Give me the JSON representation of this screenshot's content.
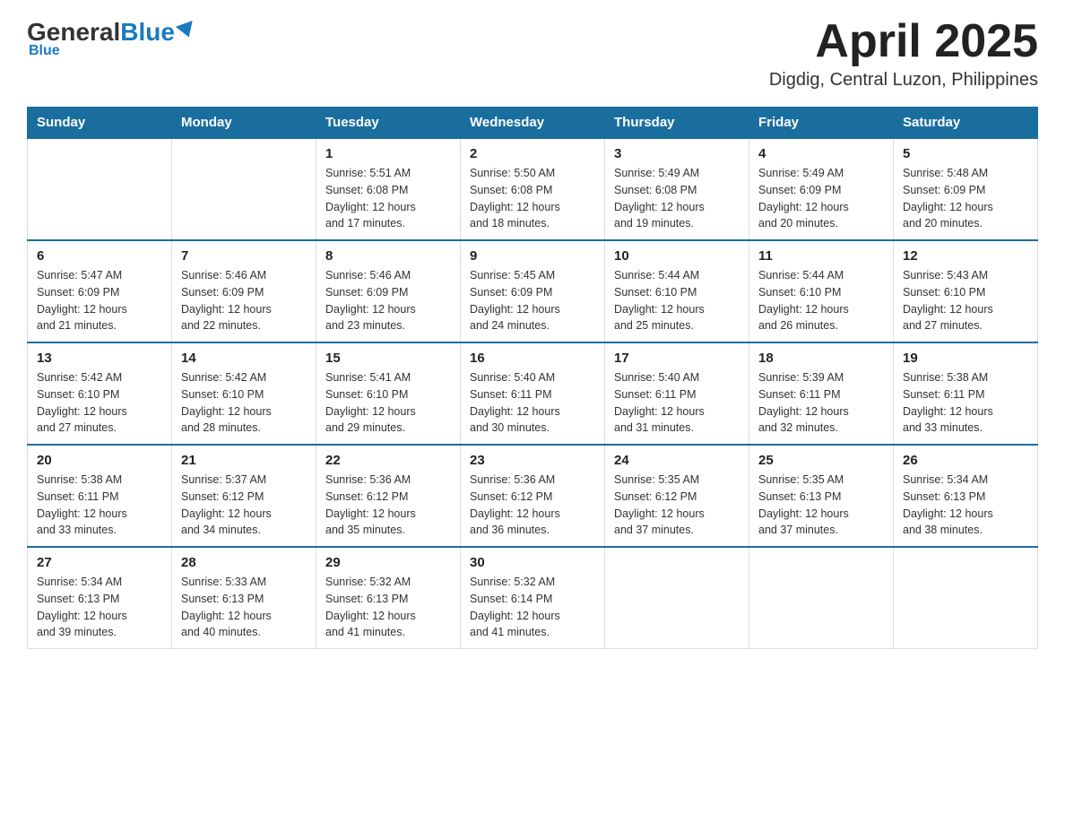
{
  "logo": {
    "general": "General",
    "blue": "Blue"
  },
  "title": "April 2025",
  "subtitle": "Digdig, Central Luzon, Philippines",
  "days_of_week": [
    "Sunday",
    "Monday",
    "Tuesday",
    "Wednesday",
    "Thursday",
    "Friday",
    "Saturday"
  ],
  "weeks": [
    [
      {
        "day": "",
        "info": ""
      },
      {
        "day": "",
        "info": ""
      },
      {
        "day": "1",
        "info": "Sunrise: 5:51 AM\nSunset: 6:08 PM\nDaylight: 12 hours\nand 17 minutes."
      },
      {
        "day": "2",
        "info": "Sunrise: 5:50 AM\nSunset: 6:08 PM\nDaylight: 12 hours\nand 18 minutes."
      },
      {
        "day": "3",
        "info": "Sunrise: 5:49 AM\nSunset: 6:08 PM\nDaylight: 12 hours\nand 19 minutes."
      },
      {
        "day": "4",
        "info": "Sunrise: 5:49 AM\nSunset: 6:09 PM\nDaylight: 12 hours\nand 20 minutes."
      },
      {
        "day": "5",
        "info": "Sunrise: 5:48 AM\nSunset: 6:09 PM\nDaylight: 12 hours\nand 20 minutes."
      }
    ],
    [
      {
        "day": "6",
        "info": "Sunrise: 5:47 AM\nSunset: 6:09 PM\nDaylight: 12 hours\nand 21 minutes."
      },
      {
        "day": "7",
        "info": "Sunrise: 5:46 AM\nSunset: 6:09 PM\nDaylight: 12 hours\nand 22 minutes."
      },
      {
        "day": "8",
        "info": "Sunrise: 5:46 AM\nSunset: 6:09 PM\nDaylight: 12 hours\nand 23 minutes."
      },
      {
        "day": "9",
        "info": "Sunrise: 5:45 AM\nSunset: 6:09 PM\nDaylight: 12 hours\nand 24 minutes."
      },
      {
        "day": "10",
        "info": "Sunrise: 5:44 AM\nSunset: 6:10 PM\nDaylight: 12 hours\nand 25 minutes."
      },
      {
        "day": "11",
        "info": "Sunrise: 5:44 AM\nSunset: 6:10 PM\nDaylight: 12 hours\nand 26 minutes."
      },
      {
        "day": "12",
        "info": "Sunrise: 5:43 AM\nSunset: 6:10 PM\nDaylight: 12 hours\nand 27 minutes."
      }
    ],
    [
      {
        "day": "13",
        "info": "Sunrise: 5:42 AM\nSunset: 6:10 PM\nDaylight: 12 hours\nand 27 minutes."
      },
      {
        "day": "14",
        "info": "Sunrise: 5:42 AM\nSunset: 6:10 PM\nDaylight: 12 hours\nand 28 minutes."
      },
      {
        "day": "15",
        "info": "Sunrise: 5:41 AM\nSunset: 6:10 PM\nDaylight: 12 hours\nand 29 minutes."
      },
      {
        "day": "16",
        "info": "Sunrise: 5:40 AM\nSunset: 6:11 PM\nDaylight: 12 hours\nand 30 minutes."
      },
      {
        "day": "17",
        "info": "Sunrise: 5:40 AM\nSunset: 6:11 PM\nDaylight: 12 hours\nand 31 minutes."
      },
      {
        "day": "18",
        "info": "Sunrise: 5:39 AM\nSunset: 6:11 PM\nDaylight: 12 hours\nand 32 minutes."
      },
      {
        "day": "19",
        "info": "Sunrise: 5:38 AM\nSunset: 6:11 PM\nDaylight: 12 hours\nand 33 minutes."
      }
    ],
    [
      {
        "day": "20",
        "info": "Sunrise: 5:38 AM\nSunset: 6:11 PM\nDaylight: 12 hours\nand 33 minutes."
      },
      {
        "day": "21",
        "info": "Sunrise: 5:37 AM\nSunset: 6:12 PM\nDaylight: 12 hours\nand 34 minutes."
      },
      {
        "day": "22",
        "info": "Sunrise: 5:36 AM\nSunset: 6:12 PM\nDaylight: 12 hours\nand 35 minutes."
      },
      {
        "day": "23",
        "info": "Sunrise: 5:36 AM\nSunset: 6:12 PM\nDaylight: 12 hours\nand 36 minutes."
      },
      {
        "day": "24",
        "info": "Sunrise: 5:35 AM\nSunset: 6:12 PM\nDaylight: 12 hours\nand 37 minutes."
      },
      {
        "day": "25",
        "info": "Sunrise: 5:35 AM\nSunset: 6:13 PM\nDaylight: 12 hours\nand 37 minutes."
      },
      {
        "day": "26",
        "info": "Sunrise: 5:34 AM\nSunset: 6:13 PM\nDaylight: 12 hours\nand 38 minutes."
      }
    ],
    [
      {
        "day": "27",
        "info": "Sunrise: 5:34 AM\nSunset: 6:13 PM\nDaylight: 12 hours\nand 39 minutes."
      },
      {
        "day": "28",
        "info": "Sunrise: 5:33 AM\nSunset: 6:13 PM\nDaylight: 12 hours\nand 40 minutes."
      },
      {
        "day": "29",
        "info": "Sunrise: 5:32 AM\nSunset: 6:13 PM\nDaylight: 12 hours\nand 41 minutes."
      },
      {
        "day": "30",
        "info": "Sunrise: 5:32 AM\nSunset: 6:14 PM\nDaylight: 12 hours\nand 41 minutes."
      },
      {
        "day": "",
        "info": ""
      },
      {
        "day": "",
        "info": ""
      },
      {
        "day": "",
        "info": ""
      }
    ]
  ]
}
